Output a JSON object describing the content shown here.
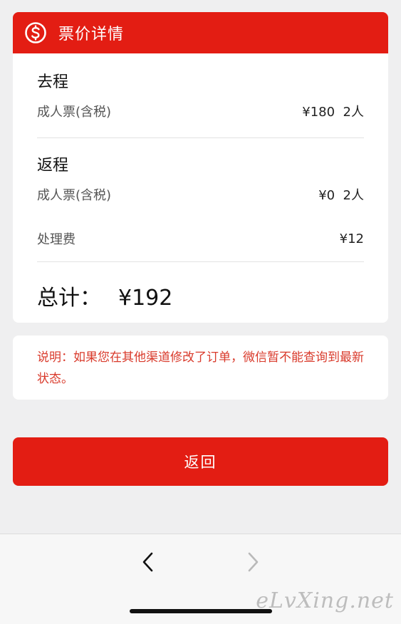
{
  "header": {
    "title": "票价详情",
    "icon": "dollar-circle-icon",
    "accent_color": "#e31d13"
  },
  "outbound": {
    "title": "去程",
    "ticket_label": "成人票(含税)",
    "ticket_value": "¥180  2人"
  },
  "return_trip": {
    "title": "返程",
    "ticket_label": "成人票(含税)",
    "ticket_value": "¥0  2人"
  },
  "fee": {
    "label": "处理费",
    "value": "¥12"
  },
  "total": {
    "label": "总计：",
    "amount": "¥192"
  },
  "note": {
    "text": "说明：如果您在其他渠道修改了订单，微信暂不能查询到最新状态。",
    "color": "#d93a2b"
  },
  "back_button": {
    "label": "返回"
  },
  "nav": {
    "back_icon": "chevron-left-icon",
    "forward_icon": "chevron-right-icon"
  },
  "watermark": {
    "text": "eLvXing.net"
  }
}
